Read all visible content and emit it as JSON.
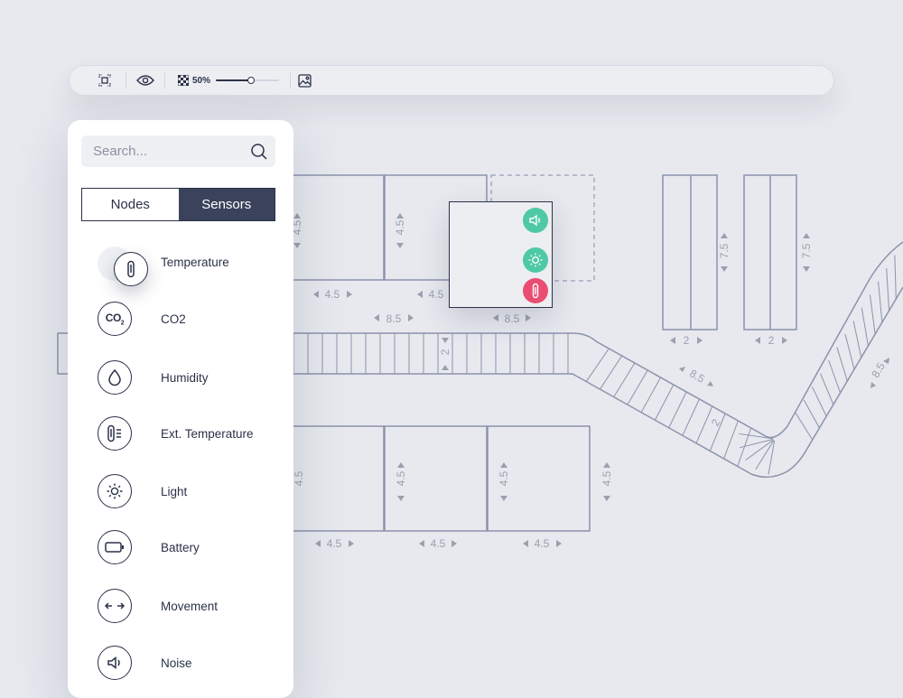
{
  "toolbar": {
    "zoom_label": "50%",
    "zoom_fraction": 0.55,
    "icons": [
      "fit-icon",
      "eye-icon",
      "checker-icon",
      "image-icon"
    ]
  },
  "panel": {
    "search_placeholder": "Search...",
    "tabs": [
      {
        "label": "Nodes",
        "active": false
      },
      {
        "label": "Sensors",
        "active": true
      }
    ],
    "sensors": [
      {
        "label": "Temperature",
        "icon": "thermometer-icon"
      },
      {
        "label": "CO2",
        "icon": "co2-icon"
      },
      {
        "label": "Humidity",
        "icon": "droplet-icon"
      },
      {
        "label": "Ext. Temperature",
        "icon": "ext-thermometer-icon"
      },
      {
        "label": "Light",
        "icon": "sun-icon"
      },
      {
        "label": "Battery",
        "icon": "battery-icon"
      },
      {
        "label": "Movement",
        "icon": "arrows-horizontal-icon"
      },
      {
        "label": "Noise",
        "icon": "speaker-icon"
      }
    ]
  },
  "node_sensors": [
    {
      "icon": "speaker-icon",
      "color": "#4fc9a5"
    },
    {
      "icon": "sun-icon",
      "color": "#4fc9a5"
    },
    {
      "icon": "thermometer-icon",
      "color": "#e94e72"
    }
  ],
  "dimensions": {
    "top_rooms_height": "4.5",
    "top_rooms_width": "4.5",
    "top_span": "8.5",
    "tall_height": "7.5",
    "tall_width": "2",
    "corridor_width": "2",
    "bottom_height": "4.5",
    "bottom_width": "4.5",
    "diagonal": "8.5"
  },
  "colors": {
    "background": "#e7e9ef",
    "line": "#8b93ab",
    "dark": "#2b3248",
    "tab_active": "#3a435b",
    "green": "#4fc9a5",
    "red": "#e94e72"
  }
}
